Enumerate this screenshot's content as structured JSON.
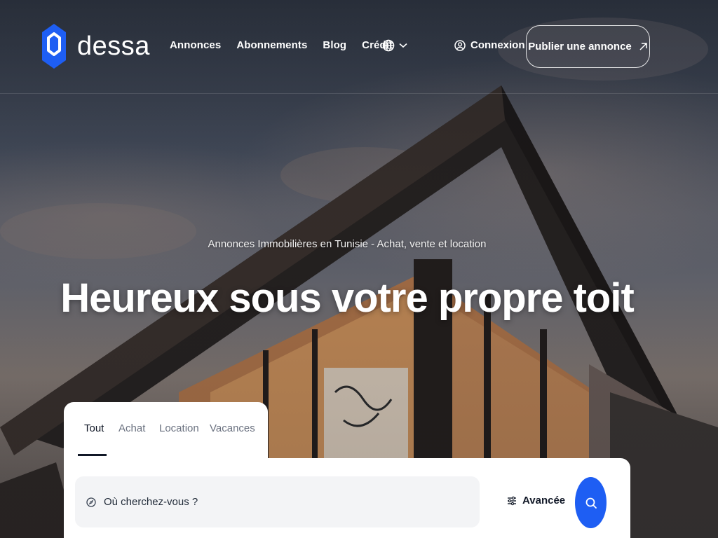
{
  "brand": {
    "name": "dessa",
    "accent": "#1e5ef3"
  },
  "nav": {
    "items": [
      {
        "label": "Annonces"
      },
      {
        "label": "Abonnements"
      },
      {
        "label": "Blog"
      },
      {
        "label": "Crédit"
      }
    ],
    "language_icon": "globe-icon",
    "login_label": "Connexion",
    "publish_label": "Publier une annonce"
  },
  "hero": {
    "subtitle": "Annonces Immobilières en Tunisie - Achat, vente et location",
    "title": "Heureux sous votre propre toit"
  },
  "search": {
    "tabs": [
      {
        "label": "Tout",
        "active": true
      },
      {
        "label": "Achat"
      },
      {
        "label": "Location"
      },
      {
        "label": "Vacances"
      }
    ],
    "placeholder": "Où cherchez-vous ?",
    "advanced_label": "Avancée"
  }
}
